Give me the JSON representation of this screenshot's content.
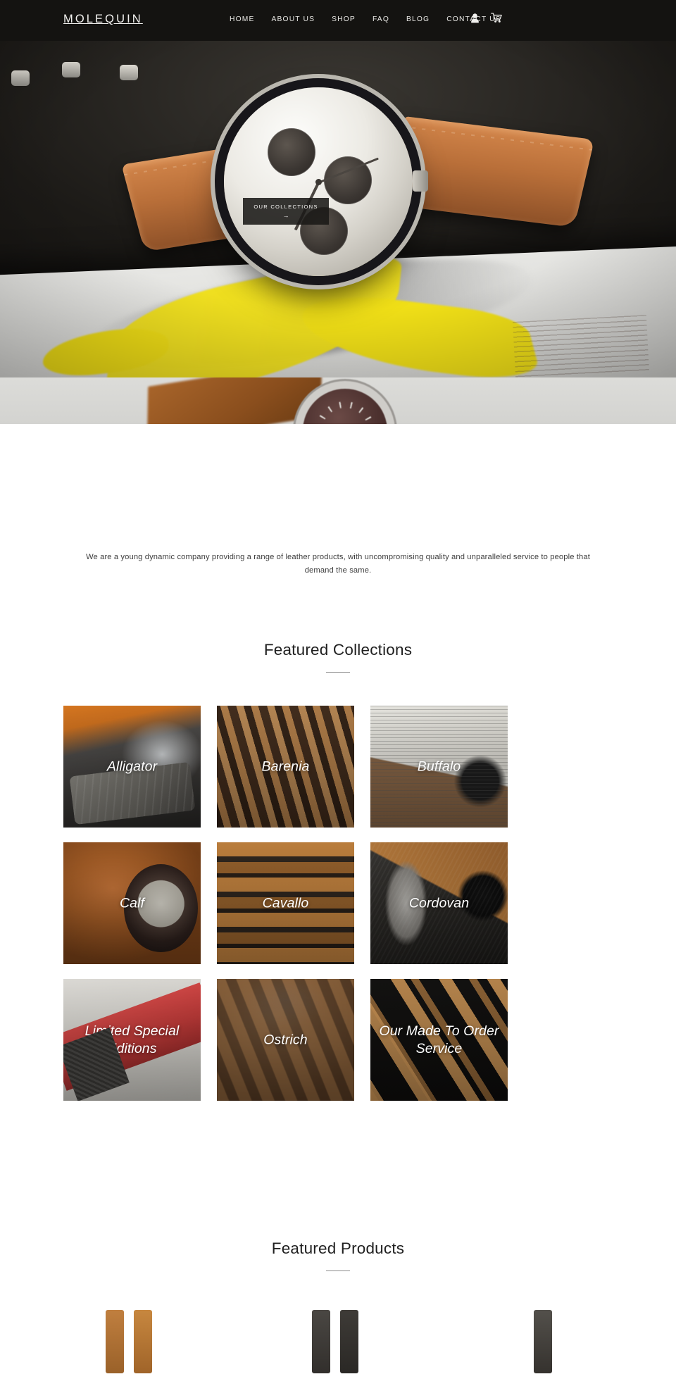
{
  "header": {
    "logo": "MOLEQUIN",
    "nav": [
      {
        "label": "HOME"
      },
      {
        "label": "ABOUT US"
      },
      {
        "label": "SHOP"
      },
      {
        "label": "FAQ"
      },
      {
        "label": "BLOG"
      },
      {
        "label": "CONTACT US"
      }
    ],
    "icons": [
      {
        "name": "account-icon"
      },
      {
        "name": "cart-icon"
      }
    ],
    "background_color": "#141311",
    "text_color": "#f2f1ef"
  },
  "hero": {
    "cta_label": "OUR COLLECTIONS",
    "cta_arrow": "→",
    "cta_background": "#1a1917"
  },
  "intro": {
    "text": "We are a young dynamic company providing a range of leather products, with uncompromising quality and unparalleled service to people that demand the same."
  },
  "collections_section": {
    "title": "Featured Collections",
    "tiles": [
      {
        "label": "Alligator",
        "art": "art-alligator"
      },
      {
        "label": "Barenia",
        "art": "art-barenia"
      },
      {
        "label": "Buffalo",
        "art": "art-buffalo"
      },
      {
        "label": "Calf",
        "art": "art-calf"
      },
      {
        "label": "Cavallo",
        "art": "art-cavallo"
      },
      {
        "label": "Cordovan",
        "art": "art-cordovan"
      },
      {
        "label": "Limited Special Editions",
        "art": "art-limited"
      },
      {
        "label": "Ostrich",
        "art": "art-ostrich"
      },
      {
        "label": "Our Made To Order Service",
        "art": "art-made"
      }
    ]
  },
  "products_section": {
    "title": "Featured Products"
  }
}
